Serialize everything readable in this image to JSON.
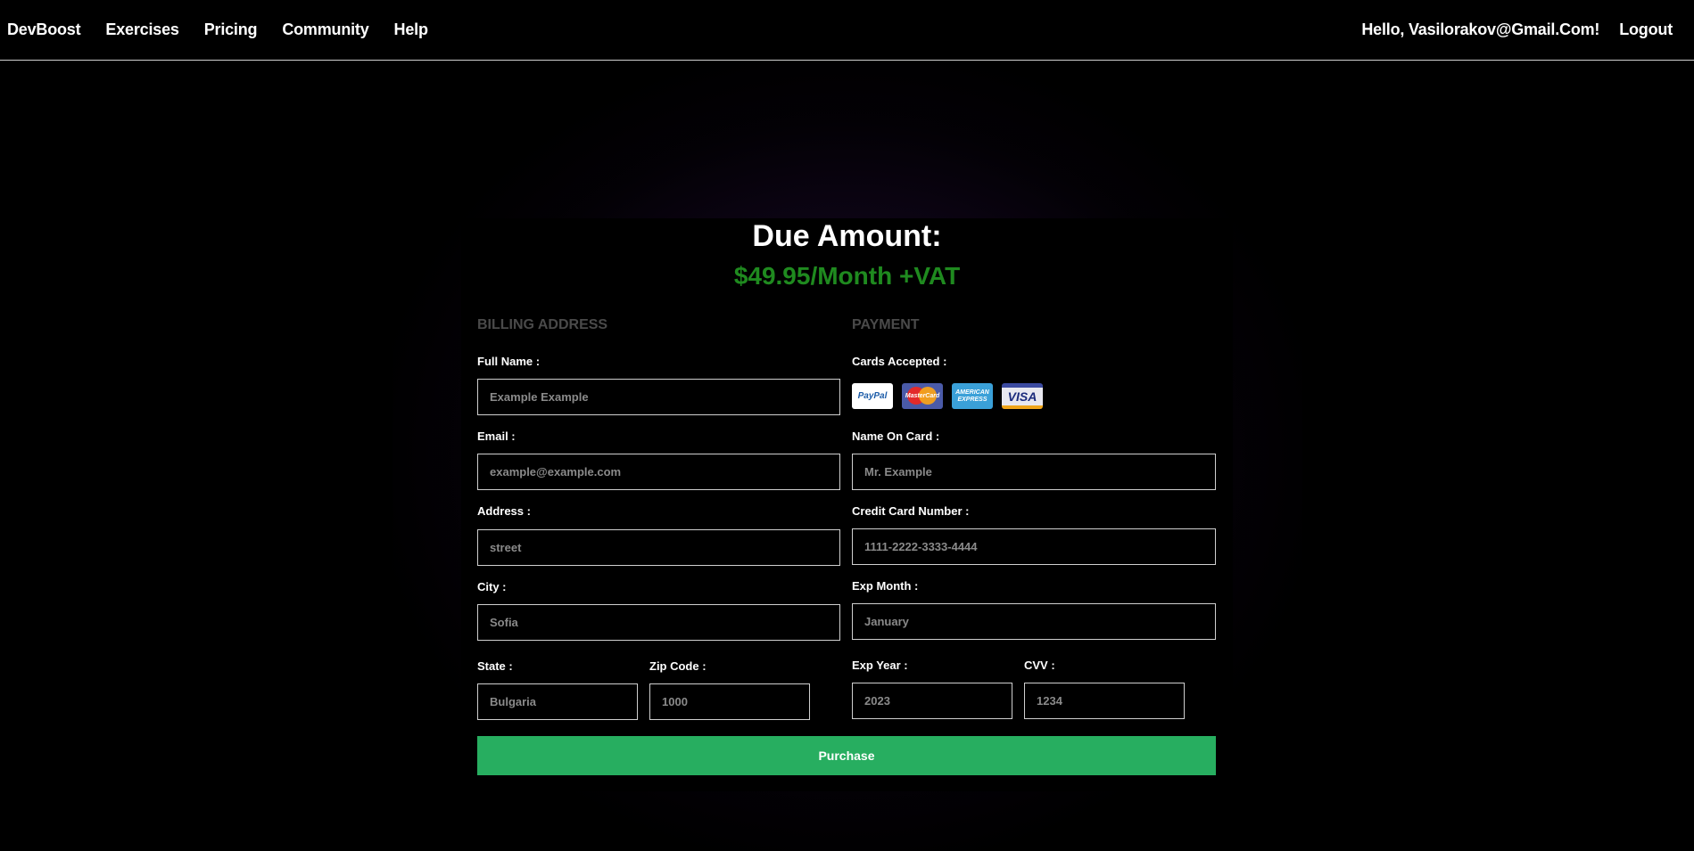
{
  "nav": {
    "brand": "DevBoost",
    "links": [
      "Exercises",
      "Pricing",
      "Community",
      "Help"
    ],
    "greeting": "Hello, Vasilorakov@Gmail.Com!",
    "logout": "Logout"
  },
  "due": {
    "title": "Due Amount:",
    "amount": "$49.95/Month +VAT",
    "amount_color": "#1f8a1f"
  },
  "billing": {
    "section_title": "BILLING ADDRESS",
    "full_name_label": "Full Name :",
    "full_name_placeholder": "Example Example",
    "email_label": "Email :",
    "email_placeholder": "example@example.com",
    "address_label": "Address :",
    "address_placeholder": "street",
    "city_label": "City :",
    "city_placeholder": "Sofia",
    "state_label": "State :",
    "state_placeholder": "Bulgaria",
    "zip_label": "Zip Code :",
    "zip_placeholder": "1000"
  },
  "payment": {
    "section_title": "PAYMENT",
    "cards_label": "Cards Accepted :",
    "cards": [
      {
        "name": "PayPal",
        "icon": "paypal-icon"
      },
      {
        "name": "MasterCard",
        "icon": "mastercard-icon"
      },
      {
        "name": "AMERICAN EXPRESS",
        "icon": "amex-icon"
      },
      {
        "name": "VISA",
        "icon": "visa-icon"
      }
    ],
    "name_on_card_label": "Name On Card :",
    "name_on_card_placeholder": "Mr. Example",
    "card_number_label": "Credit Card Number :",
    "card_number_placeholder": "1111-2222-3333-4444",
    "exp_month_label": "Exp Month :",
    "exp_month_placeholder": "January",
    "exp_year_label": "Exp Year :",
    "exp_year_placeholder": "2023",
    "cvv_label": "CVV :",
    "cvv_placeholder": "1234"
  },
  "purchase_button": "Purchase",
  "colors": {
    "accent_green": "#27ae60",
    "section_title_gray": "#4a4a4a"
  }
}
